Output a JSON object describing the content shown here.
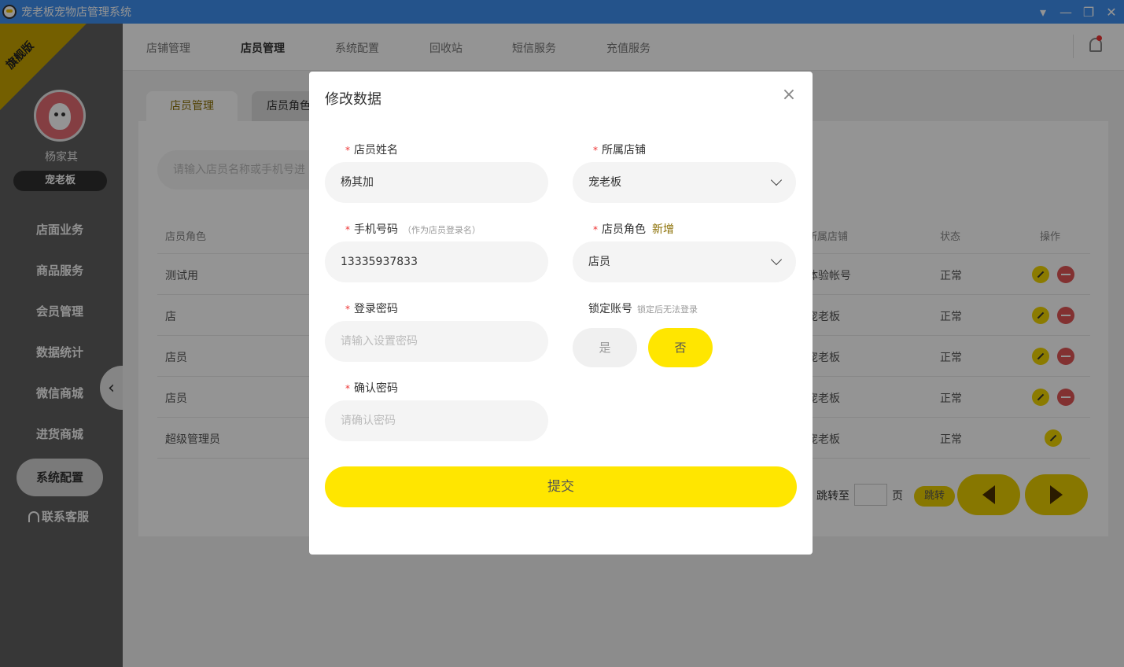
{
  "window": {
    "title": "宠老板宠物店管理系统",
    "controls": [
      "▾",
      "—",
      "❐",
      "✕"
    ]
  },
  "sidebar": {
    "edition": "旗舰版",
    "user_name": "杨家其",
    "shop": "宠老板",
    "items": [
      {
        "label": "店面业务"
      },
      {
        "label": "商品服务"
      },
      {
        "label": "会员管理"
      },
      {
        "label": "数据统计"
      },
      {
        "label": "微信商城"
      },
      {
        "label": "进货商城"
      },
      {
        "label": "系统配置"
      }
    ],
    "support": "联系客服",
    "collapse": "‹"
  },
  "topnav": {
    "tabs": [
      {
        "label": "店铺管理"
      },
      {
        "label": "店员管理"
      },
      {
        "label": "系统配置"
      },
      {
        "label": "回收站"
      },
      {
        "label": "短信服务"
      },
      {
        "label": "充值服务"
      }
    ]
  },
  "subtabs": [
    {
      "label": "店员管理"
    },
    {
      "label": "店员角色"
    }
  ],
  "search": {
    "placeholder": "请输入店员名称或手机号进"
  },
  "table": {
    "headers": {
      "role": "店员角色",
      "shop": "所属店铺",
      "status": "状态",
      "actions": "操作"
    },
    "rows": [
      {
        "role": "测试用",
        "shop": "体验帐号",
        "status": "正常"
      },
      {
        "role": "店",
        "shop": "宠老板",
        "status": "正常"
      },
      {
        "role": "店员",
        "shop": "宠老板",
        "status": "正常"
      },
      {
        "role": "店员",
        "shop": "宠老板",
        "status": "正常"
      },
      {
        "role": "超级管理员",
        "shop": "宠老板",
        "status": "正常"
      }
    ]
  },
  "pager": {
    "jump_to": "跳转至",
    "page": "页",
    "go": "跳转"
  },
  "modal": {
    "title": "修改数据",
    "close": "×",
    "name_label": "店员姓名",
    "name_value": "杨其加",
    "shop_label": "所属店铺",
    "shop_value": "宠老板",
    "phone_label": "手机号码",
    "phone_hint": "（作为店员登录名）",
    "phone_value": "13335937833",
    "role_label": "店员角色",
    "role_add": "新增",
    "role_value": "店员",
    "password_label": "登录密码",
    "password_placeholder": "请输入设置密码",
    "lock_label": "锁定账号",
    "lock_hint": "锁定后无法登录",
    "lock_yes": "是",
    "lock_no": "否",
    "confirm_label": "确认密码",
    "confirm_placeholder": "请确认密码",
    "submit": "提交",
    "required_mark": "*"
  }
}
